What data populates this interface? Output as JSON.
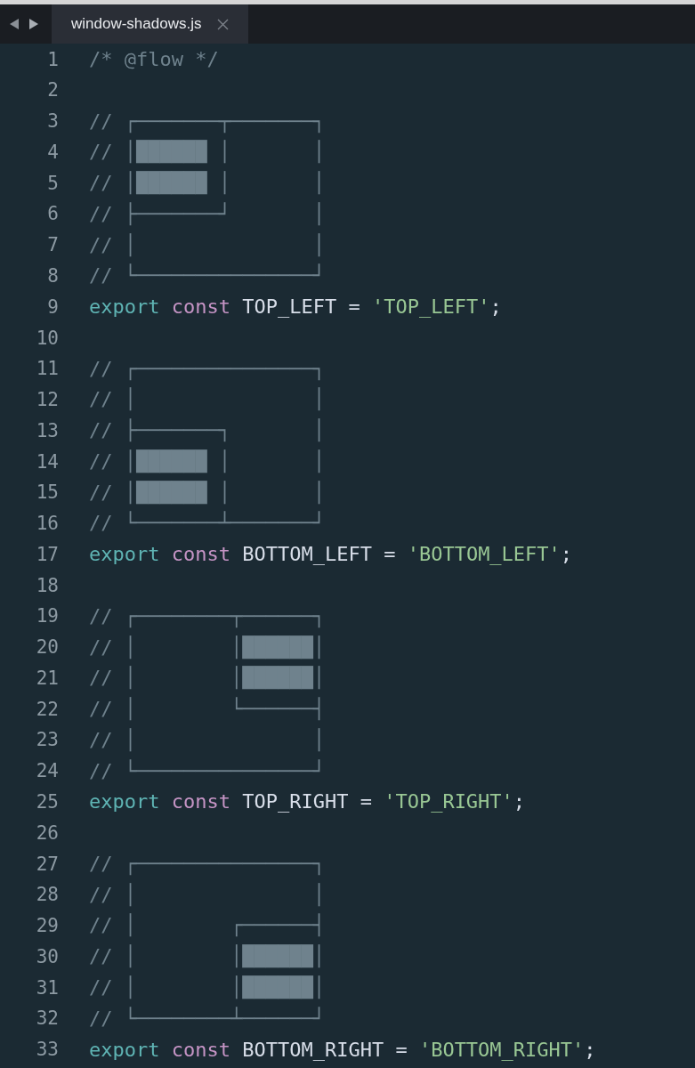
{
  "tabs": [
    {
      "label": "window-shadows.js",
      "selected": true
    }
  ],
  "lines": [
    {
      "number": "1",
      "tokens": [
        {
          "kind": "comment",
          "text": "/* @flow */"
        }
      ]
    },
    {
      "number": "2"
    },
    {
      "number": "3",
      "tokens": [
        {
          "kind": "comment",
          "text": "// ┌───────┬───────┐"
        }
      ]
    },
    {
      "number": "4",
      "tokens": [
        {
          "kind": "comment",
          "text": "// │██████ │       │"
        }
      ]
    },
    {
      "number": "5",
      "tokens": [
        {
          "kind": "comment",
          "text": "// │██████ │       │"
        }
      ]
    },
    {
      "number": "6",
      "tokens": [
        {
          "kind": "comment",
          "text": "// ├───────┘       │"
        }
      ]
    },
    {
      "number": "7",
      "tokens": [
        {
          "kind": "comment",
          "text": "// │               │"
        }
      ]
    },
    {
      "number": "8",
      "tokens": [
        {
          "kind": "comment",
          "text": "// └───────────────┘"
        }
      ]
    },
    {
      "number": "9",
      "tokens": [
        {
          "kind": "keyword",
          "text": "export"
        },
        {
          "kind": "storage",
          "text": " const"
        },
        {
          "kind": "plain",
          "text": " TOP_LEFT = "
        },
        {
          "kind": "string",
          "text": "'TOP_LEFT'"
        },
        {
          "kind": "plain",
          "text": ";"
        }
      ]
    },
    {
      "number": "10"
    },
    {
      "number": "11",
      "tokens": [
        {
          "kind": "comment",
          "text": "// ┌───────────────┐"
        }
      ]
    },
    {
      "number": "12",
      "tokens": [
        {
          "kind": "comment",
          "text": "// │               │"
        }
      ]
    },
    {
      "number": "13",
      "tokens": [
        {
          "kind": "comment",
          "text": "// ├───────┐       │"
        }
      ]
    },
    {
      "number": "14",
      "tokens": [
        {
          "kind": "comment",
          "text": "// │██████ │       │"
        }
      ]
    },
    {
      "number": "15",
      "tokens": [
        {
          "kind": "comment",
          "text": "// │██████ │       │"
        }
      ]
    },
    {
      "number": "16",
      "tokens": [
        {
          "kind": "comment",
          "text": "// └───────┴───────┘"
        }
      ]
    },
    {
      "number": "17",
      "tokens": [
        {
          "kind": "keyword",
          "text": "export"
        },
        {
          "kind": "storage",
          "text": " const"
        },
        {
          "kind": "plain",
          "text": " BOTTOM_LEFT = "
        },
        {
          "kind": "string",
          "text": "'BOTTOM_LEFT'"
        },
        {
          "kind": "plain",
          "text": ";"
        }
      ]
    },
    {
      "number": "18"
    },
    {
      "number": "19",
      "tokens": [
        {
          "kind": "comment",
          "text": "// ┌────────┬──────┐"
        }
      ]
    },
    {
      "number": "20",
      "tokens": [
        {
          "kind": "comment",
          "text": "// │        │██████│"
        }
      ]
    },
    {
      "number": "21",
      "tokens": [
        {
          "kind": "comment",
          "text": "// │        │██████│"
        }
      ]
    },
    {
      "number": "22",
      "tokens": [
        {
          "kind": "comment",
          "text": "// │        └──────┤"
        }
      ]
    },
    {
      "number": "23",
      "tokens": [
        {
          "kind": "comment",
          "text": "// │               │"
        }
      ]
    },
    {
      "number": "24",
      "tokens": [
        {
          "kind": "comment",
          "text": "// └───────────────┘"
        }
      ]
    },
    {
      "number": "25",
      "tokens": [
        {
          "kind": "keyword",
          "text": "export"
        },
        {
          "kind": "storage",
          "text": " const"
        },
        {
          "kind": "plain",
          "text": " TOP_RIGHT = "
        },
        {
          "kind": "string",
          "text": "'TOP_RIGHT'"
        },
        {
          "kind": "plain",
          "text": ";"
        }
      ]
    },
    {
      "number": "26"
    },
    {
      "number": "27",
      "tokens": [
        {
          "kind": "comment",
          "text": "// ┌───────────────┐"
        }
      ]
    },
    {
      "number": "28",
      "tokens": [
        {
          "kind": "comment",
          "text": "// │               │"
        }
      ]
    },
    {
      "number": "29",
      "tokens": [
        {
          "kind": "comment",
          "text": "// │        ┌──────┤"
        }
      ]
    },
    {
      "number": "30",
      "tokens": [
        {
          "kind": "comment",
          "text": "// │        │██████│"
        }
      ]
    },
    {
      "number": "31",
      "tokens": [
        {
          "kind": "comment",
          "text": "// │        │██████│"
        }
      ]
    },
    {
      "number": "32",
      "tokens": [
        {
          "kind": "comment",
          "text": "// └────────┴──────┘"
        }
      ]
    },
    {
      "number": "33",
      "tokens": [
        {
          "kind": "keyword",
          "text": "export"
        },
        {
          "kind": "storage",
          "text": " const"
        },
        {
          "kind": "plain",
          "text": " BOTTOM_RIGHT = "
        },
        {
          "kind": "string",
          "text": "'BOTTOM_RIGHT'"
        },
        {
          "kind": "plain",
          "text": ";"
        }
      ]
    }
  ]
}
